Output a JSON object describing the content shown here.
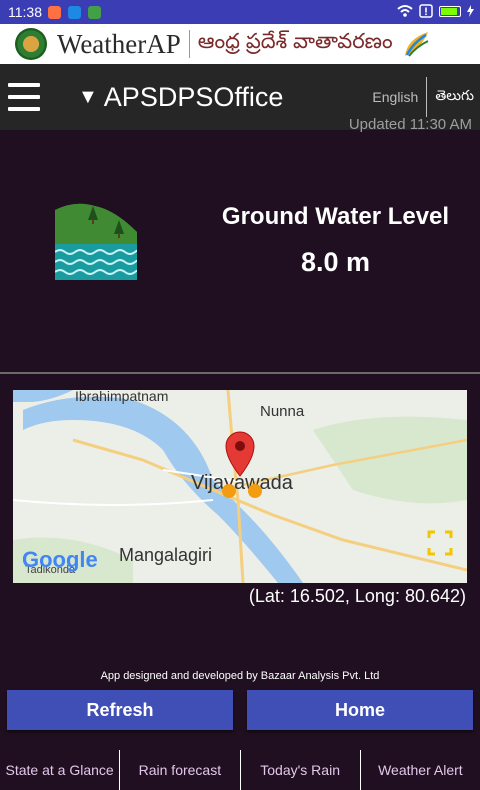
{
  "status_bar": {
    "time": "11:38"
  },
  "brand": {
    "app_name": "WeatherAP",
    "telugu_name": "ఆంధ్ర ప్రదేశ్ వాతావరణం"
  },
  "toolbar": {
    "office": "APSDPSOffice",
    "lang_english": "English",
    "lang_telugu": "తెలుగు"
  },
  "updated_text": "Updated 11:30 AM",
  "metric": {
    "title": "Ground Water Level",
    "value": "8.0 m"
  },
  "map": {
    "labels": {
      "ibrahimpatnam": "Ibrahimpatnam",
      "nunna": "Nunna",
      "vijayawada": "Vijayawada",
      "mangalagiri": "Mangalagiri",
      "tadikonda": "Tadikonda",
      "google": "Google"
    }
  },
  "coordinates": "(Lat: 16.502, Long: 80.642)",
  "credit": "App designed and developed by Bazaar Analysis Pvt. Ltd",
  "buttons": {
    "refresh": "Refresh",
    "home": "Home"
  },
  "bottom_nav": [
    "State at a Glance",
    "Rain forecast",
    "Today's Rain",
    "Weather Alert"
  ],
  "colors": {
    "status_bar": "#3b3db5",
    "background": "#1f0f20",
    "toolbar": "#262626",
    "button": "#3f4fb6",
    "nav_text": "#e3c7e9"
  }
}
